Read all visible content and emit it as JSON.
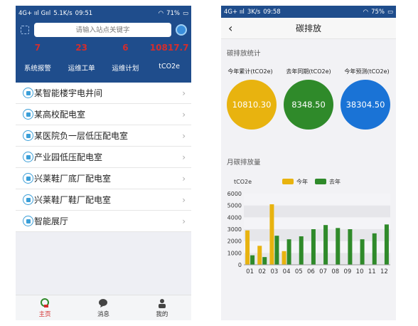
{
  "left": {
    "status": {
      "network": "4G+ ııl Gııl",
      "speed": "5.1K/s",
      "time": "09:51",
      "battery": "71%"
    },
    "search": {
      "placeholder": "请输入站点关键字"
    },
    "stats": [
      {
        "value": "7",
        "label": "系统报警"
      },
      {
        "value": "23",
        "label": "运维工单"
      },
      {
        "value": "6",
        "label": "运维计划"
      },
      {
        "value": "10817.7",
        "label": "tCO2e"
      }
    ],
    "rooms": [
      "某智能楼宇电井间",
      "某高校配电室",
      "某医院负一层低压配电室",
      "产业园低压配电室",
      "兴莱鞋厂底厂配电室",
      "兴莱鞋厂鞋厂配电室",
      "智能展厅"
    ],
    "tabs": [
      {
        "label": "主页",
        "icon": "home-icon",
        "active": true
      },
      {
        "label": "消息",
        "icon": "message-icon",
        "active": false
      },
      {
        "label": "我的",
        "icon": "user-icon",
        "active": false
      }
    ],
    "colors": {
      "header": "#1f4d8c",
      "stat_value": "#d42d2d",
      "room_icon": "#3b9fd8"
    }
  },
  "right": {
    "status": {
      "network": "4G+ ııl",
      "speed": "3K/s",
      "time": "09:58",
      "battery": "75%"
    },
    "title": "碳排放",
    "stats_section": "碳排放统计",
    "circles": [
      {
        "label": "今年累计(tCO2e)",
        "value": "10810.30",
        "color": "#e8b30f"
      },
      {
        "label": "去年同期(tCO2e)",
        "value": "8348.50",
        "color": "#2f8a2a"
      },
      {
        "label": "今年预测(tCO2e)",
        "value": "38304.50",
        "color": "#1a73d6"
      }
    ],
    "monthly_section": "月碳排放量"
  },
  "chart_data": {
    "type": "bar",
    "ylabel": "tCO2e",
    "ylim": [
      0,
      6000
    ],
    "yticks": [
      0,
      1000,
      2000,
      3000,
      4000,
      5000,
      6000
    ],
    "grid": "horizontal bands",
    "legend": "top",
    "categories": [
      "01",
      "02",
      "03",
      "04",
      "05",
      "06",
      "07",
      "08",
      "09",
      "10",
      "11",
      "12"
    ],
    "series": [
      {
        "name": "今年",
        "color": "#e8b30f",
        "values": [
          2900,
          1600,
          5100,
          1150,
          null,
          null,
          null,
          null,
          null,
          null,
          null,
          null
        ]
      },
      {
        "name": "去年",
        "color": "#2f8a2a",
        "values": [
          800,
          650,
          2450,
          2150,
          2400,
          3000,
          3350,
          3100,
          3000,
          2150,
          2650,
          3400
        ]
      }
    ]
  }
}
